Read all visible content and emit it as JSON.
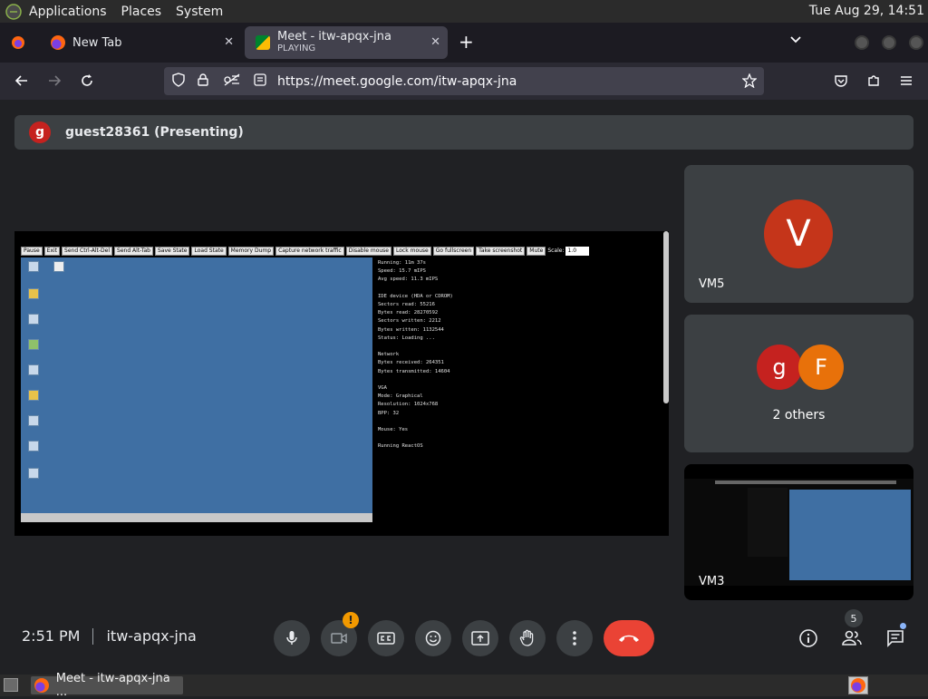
{
  "top_panel": {
    "menus": [
      "Applications",
      "Places",
      "System"
    ],
    "clock": "Tue Aug 29, 14:51"
  },
  "browser": {
    "tabs": [
      {
        "title": "New Tab",
        "subtitle": ""
      },
      {
        "title": "Meet - itw-apqx-jna",
        "subtitle": "PLAYING"
      }
    ],
    "url": "https://meet.google.com/itw-apqx-jna"
  },
  "meet": {
    "presenter": {
      "avatar_letter": "g",
      "label": "guest28361 (Presenting)"
    },
    "shared_screen": {
      "buttons": [
        "Pause",
        "Exit",
        "Send Ctrl-Alt-Del",
        "Send Alt-Tab",
        "Save State",
        "Load State",
        "Memory Dump",
        "Capture network traffic",
        "Disable mouse",
        "Lock mouse",
        "Go fullscreen",
        "Take screenshot",
        "Mute"
      ],
      "scale_label": "Scale:",
      "scale_value": "1.0",
      "stats": "Running: 11m 37s\nSpeed: 15.7 mIPS\nAvg speed: 11.3 mIPS\n\nIDE device (HDA or CDROM)\nSectors read: 55216\nBytes read: 28270592\nSectors written: 2212\nBytes written: 1132544\nStatus: Loading ...\n\nNetwork\nBytes received: 264351\nBytes transmitted: 14604\n\nVGA\nMode: Graphical\nResolution: 1024x768\nBPP: 32\n\nMouse: Yes\n\nRunning ReactOS"
    },
    "participants": [
      {
        "name": "VM5",
        "avatar_letter": "V"
      },
      {
        "name": "2 others",
        "avatar_letters": [
          "g",
          "F"
        ]
      },
      {
        "name": "VM3"
      }
    ],
    "bottom": {
      "time": "2:51 PM",
      "meeting_code": "itw-apqx-jna",
      "people_count": "5"
    }
  },
  "taskbar": {
    "task_label": "Meet - itw-apqx-jna ..."
  },
  "colors": {
    "end_call": "#ea4335",
    "vm5_avatar": "#c5351a",
    "g_avatar": "#c5221f",
    "f_avatar": "#e8710a"
  }
}
